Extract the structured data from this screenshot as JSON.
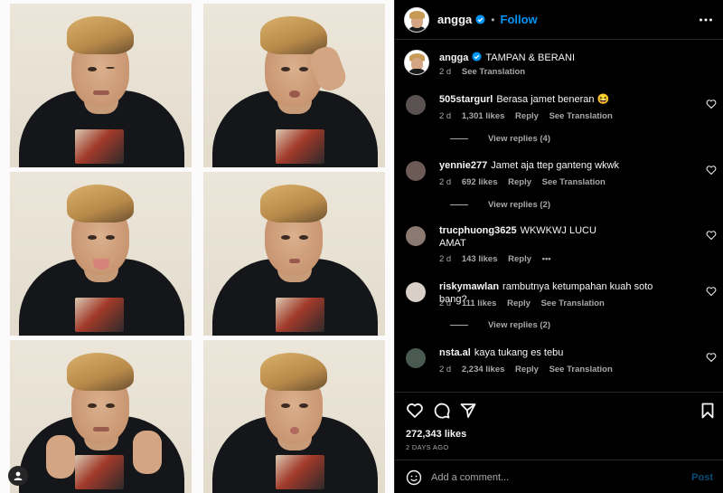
{
  "post": {
    "username": "angga",
    "follow_label": "Follow",
    "separator": "•",
    "caption_text": "TAMPAN & BERANI",
    "caption_time": "2 d",
    "caption_translate": "See Translation",
    "likes": "272,343 likes",
    "posted_ago": "2 DAYS AGO",
    "comment_placeholder": "Add a comment...",
    "post_label": "Post"
  },
  "comments": [
    {
      "user": "505stargurl",
      "text": "Berasa jamet beneran 😆",
      "time": "2 d",
      "likes": "1,301 likes",
      "reply": "Reply",
      "translate": "See Translation",
      "replies": "View replies (4)"
    },
    {
      "user": "yennie277",
      "text": "Jamet aja ttep ganteng wkwk",
      "time": "2 d",
      "likes": "692 likes",
      "reply": "Reply",
      "translate": "See Translation",
      "replies": "View replies (2)"
    },
    {
      "user": "trucphuong3625",
      "text": "WKWKWJ LUCU AMAT",
      "time": "2 d",
      "likes": "143 likes",
      "reply": "Reply",
      "more": "•••"
    },
    {
      "user": "riskymawlan",
      "text": "rambutnya ketumpahan kuah soto bang?",
      "time": "2 d",
      "likes": "111 likes",
      "reply": "Reply",
      "translate": "See Translation",
      "replies": "View replies (2)"
    },
    {
      "user": "nsta.al",
      "text": "kaya tukang es tebu",
      "time": "2 d",
      "likes": "2,234 likes",
      "reply": "Reply",
      "translate": "See Translation"
    }
  ],
  "colors": {
    "accent": "#0095f6",
    "background": "#000000",
    "muted": "#a8a8a8"
  },
  "icons": [
    "more-icon",
    "verified-badge-icon",
    "heart-icon",
    "comment-icon",
    "share-icon",
    "bookmark-icon",
    "emoji-icon",
    "user-tag-icon"
  ]
}
